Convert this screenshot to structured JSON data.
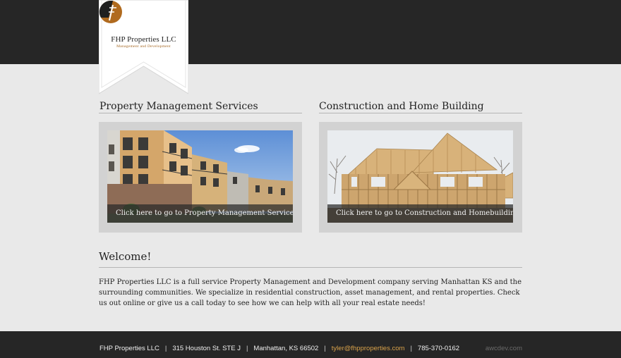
{
  "logo": {
    "name": "FHP Properties LLC",
    "tagline": "Management and Development",
    "colors": {
      "accent": "#b06a1e",
      "dark": "#1f1f1f"
    }
  },
  "services": [
    {
      "heading": "Property Management Services",
      "caption": "Click here to go to Property Management Services",
      "image": "apartment-building-photo"
    },
    {
      "heading": "Construction and Home Building",
      "caption": "Click here to go to Construction and Homebuilding",
      "image": "house-framing-photo"
    }
  ],
  "welcome": {
    "title": "Welcome!",
    "text": "FHP Properties LLC is a full service Property Management and Development company serving Manhattan KS and the surrounding communities. We specialize in residential construction, asset management, and rental properties. Check us out online or give us a call today to see how we can help with all your real estate needs!"
  },
  "footer": {
    "company": "FHP Properties LLC",
    "address": "315 Houston St. STE J",
    "city": "Manhattan, KS 66502",
    "email": "tyler@fhpproperties.com",
    "phone": "785-370-0162",
    "separator": "|",
    "credit": "awcdev.com"
  }
}
